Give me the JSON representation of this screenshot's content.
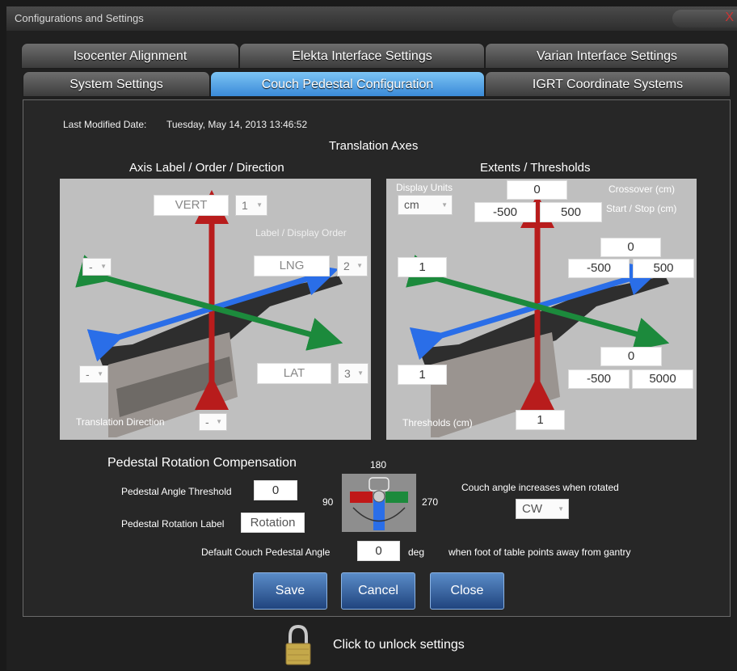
{
  "window": {
    "title": "Configurations and Settings",
    "close_glyph": "X"
  },
  "tabs": {
    "row1": [
      "Isocenter Alignment",
      "Elekta Interface Settings",
      "Varian Interface Settings"
    ],
    "row2": [
      "System Settings",
      "Couch Pedestal Configuration",
      "IGRT Coordinate Systems"
    ],
    "active": "Couch Pedestal Configuration"
  },
  "meta": {
    "last_modified_label": "Last Modified Date:",
    "last_modified_value": "Tuesday, May 14, 2013 13:46:52"
  },
  "translation_axes": {
    "title": "Translation Axes",
    "left": {
      "title": "Axis Label / Order / Direction",
      "label_display_order": "Label / Display Order",
      "translation_direction_label": "Translation Direction",
      "vert": {
        "label": "VERT",
        "order": "1",
        "direction": ""
      },
      "lng": {
        "label": "LNG",
        "order": "2",
        "direction": "-"
      },
      "lat": {
        "label": "LAT",
        "order": "3",
        "direction": "-"
      },
      "translation_direction_value": "-"
    },
    "right": {
      "title": "Extents / Thresholds",
      "display_units_label": "Display Units",
      "display_units_value": "cm",
      "crossover_label": "Crossover (cm)",
      "start_stop_label": "Start / Stop (cm)",
      "thresholds_label": "Thresholds (cm)",
      "vert": {
        "crossover": "0",
        "start": "-500",
        "stop": "500",
        "threshold": "1"
      },
      "lng": {
        "crossover": "0",
        "start": "-500",
        "stop": "500",
        "threshold": "1"
      },
      "lat": {
        "crossover": "0",
        "start": "-500",
        "stop": "5000",
        "threshold": "1"
      }
    }
  },
  "pedestal": {
    "title": "Pedestal Rotation Compensation",
    "angle_threshold_label": "Pedestal Angle Threshold",
    "angle_threshold_value": "0",
    "rotation_label_label": "Pedestal Rotation Label",
    "rotation_label_value": "Rotation",
    "angle_180": "180",
    "angle_90": "90",
    "angle_270": "270",
    "couch_angle_increases_label": "Couch angle increases when rotated",
    "couch_angle_direction": "CW",
    "default_angle_label": "Default Couch Pedestal Angle",
    "default_angle_value": "0",
    "default_angle_unit": "deg",
    "default_angle_note": "when foot of table points away from gantry"
  },
  "buttons": {
    "save": "Save",
    "cancel": "Cancel",
    "close": "Close"
  },
  "footer": {
    "unlock_text": "Click to unlock settings"
  },
  "colors": {
    "vert_arrow": "#b81c1c",
    "lng_arrow": "#2a6ee8",
    "lat_arrow": "#1c8a3c",
    "active_tab": "#58a8e8"
  },
  "icons": [
    "close-icon",
    "dropdown-arrow-icon",
    "lock-icon",
    "couch-rotation-icon"
  ]
}
